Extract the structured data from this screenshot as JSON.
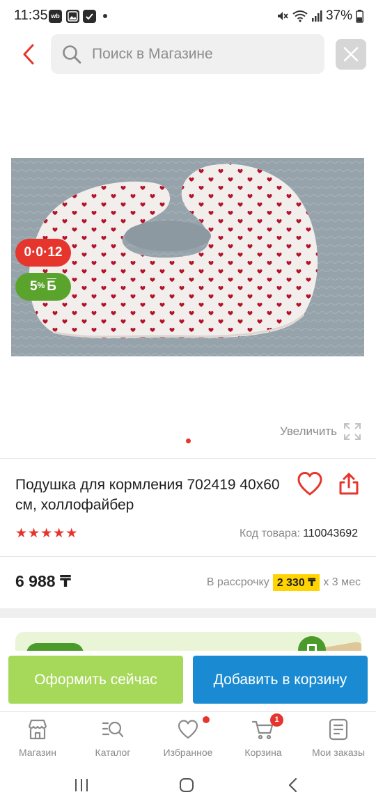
{
  "status_bar": {
    "time": "11:35",
    "wb_label": "wb",
    "battery": "37%"
  },
  "search": {
    "placeholder": "Поиск в Магазине"
  },
  "badges": {
    "timer": "0·0·12",
    "bonus_value": "5",
    "bonus_suffix": "Б"
  },
  "gallery": {
    "zoom_label": "Увеличить"
  },
  "product": {
    "title": "Подушка для кормления 702419 40х60 см, холлофайбер",
    "rating_stars": 5,
    "code_label": "Код товара:",
    "code_value": "110043692",
    "price": "6 988 ₸",
    "installment_prefix": "В рассрочку",
    "installment_amount": "2 330 ₸",
    "installment_suffix": "х 3 мес"
  },
  "actions": {
    "checkout": "Оформить сейчас",
    "add_to_cart": "Добавить в корзину"
  },
  "nav": {
    "items": [
      {
        "label": "Магазин",
        "icon": "store-icon"
      },
      {
        "label": "Каталог",
        "icon": "catalog-search-icon"
      },
      {
        "label": "Избранное",
        "icon": "heart-icon"
      },
      {
        "label": "Корзина",
        "icon": "cart-icon",
        "badge": "1"
      },
      {
        "label": "Мои заказы",
        "icon": "orders-icon"
      }
    ]
  },
  "colors": {
    "accent_red": "#e5352c",
    "checkout_green": "#a6d95a",
    "cart_blue": "#1a8bd2",
    "installment_yellow": "#ffd400"
  }
}
